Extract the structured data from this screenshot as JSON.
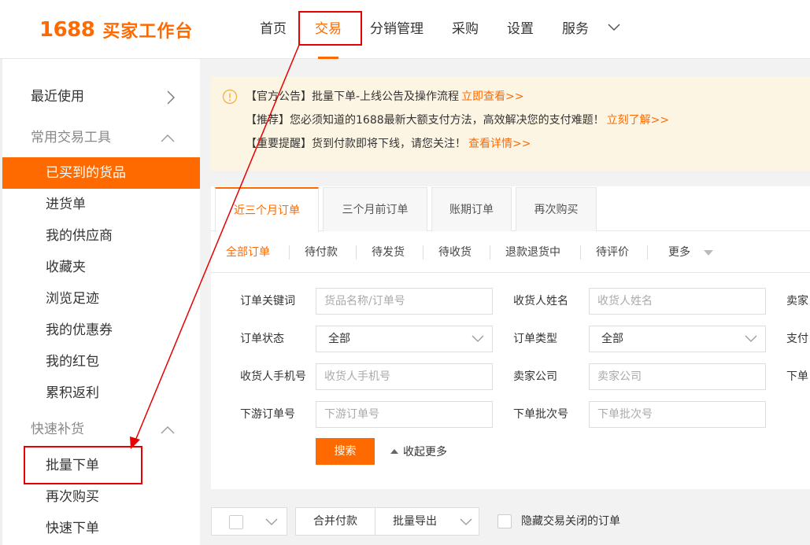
{
  "header": {
    "logo_num": "1688",
    "logo_text": "买家工作台",
    "nav": [
      {
        "label": "首页"
      },
      {
        "label": "交易"
      },
      {
        "label": "分销管理"
      },
      {
        "label": "采购"
      },
      {
        "label": "设置"
      },
      {
        "label": "服务"
      }
    ],
    "active_nav": "交易"
  },
  "sidebar": {
    "recent": "最近使用",
    "group_tools": "常用交易工具",
    "items_tools": [
      "已买到的货品",
      "进货单",
      "我的供应商",
      "收藏夹",
      "浏览足迹",
      "我的优惠券",
      "我的红包",
      "累积返利"
    ],
    "active_item": "已买到的货品",
    "group_restock": "快速补货",
    "items_restock": [
      "批量下单",
      "再次购买",
      "快速下单"
    ]
  },
  "notice": {
    "lines": [
      {
        "text": "【官方公告】批量下单-上线公告及操作流程",
        "link": "立即查看>>"
      },
      {
        "text": "【推荐】您必须知道的1688最新大额支付方法，高效解决您的支付难题！",
        "link": "立刻了解>>"
      },
      {
        "text": "【重要提醒】货到付款即将下线，请您关注！",
        "link": "查看详情>>"
      }
    ]
  },
  "tabs": [
    "近三个月订单",
    "三个月前订单",
    "账期订单",
    "再次购买"
  ],
  "active_tab": "近三个月订单",
  "status_filters": [
    "全部订单",
    "待付款",
    "待发货",
    "待收货",
    "退款退货中",
    "待评价",
    "更多"
  ],
  "form": {
    "keyword_label": "订单关键词",
    "keyword_placeholder": "货品名称/订单号",
    "receiver_name_label": "收货人姓名",
    "receiver_name_placeholder": "收货人姓名",
    "seller_label_cut": "卖家",
    "order_status_label": "订单状态",
    "order_status_value": "全部",
    "order_type_label": "订单类型",
    "order_type_value": "全部",
    "pay_label_cut": "支付",
    "phone_label": "收货人手机号",
    "phone_placeholder": "收货人手机号",
    "seller_company_label": "卖家公司",
    "seller_company_placeholder": "卖家公司",
    "order_label_cut": "下单",
    "downstream_label": "下游订单号",
    "downstream_placeholder": "下游订单号",
    "batch_label": "下单批次号",
    "batch_placeholder": "下单批次号",
    "search_button": "搜索",
    "collapse_text": "收起更多"
  },
  "toolbar": {
    "merge_pay": "合并付款",
    "batch_export": "批量导出",
    "hide_closed": "隐藏交易关闭的订单"
  },
  "annotation": {
    "color": "#e60000"
  }
}
